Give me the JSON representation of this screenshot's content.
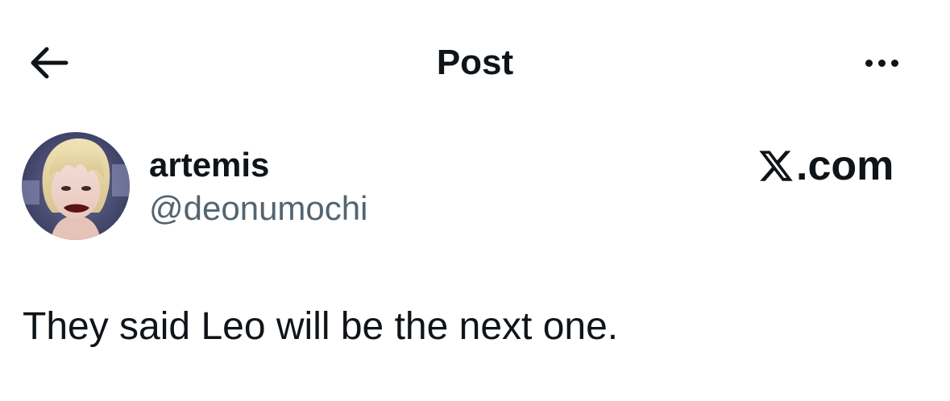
{
  "header": {
    "back_icon": "arrow-left-icon",
    "title": "Post",
    "more_icon": "more-horizontal-icon"
  },
  "author": {
    "display_name": "artemis",
    "handle": "@deonumochi",
    "avatar_icon": "profile-photo"
  },
  "watermark": {
    "icon": "x-logo-icon",
    "text": ".com"
  },
  "post": {
    "text": "They said Leo will be the next one."
  },
  "colors": {
    "text_primary": "#0f1419",
    "text_secondary": "#536471",
    "background": "#ffffff"
  }
}
